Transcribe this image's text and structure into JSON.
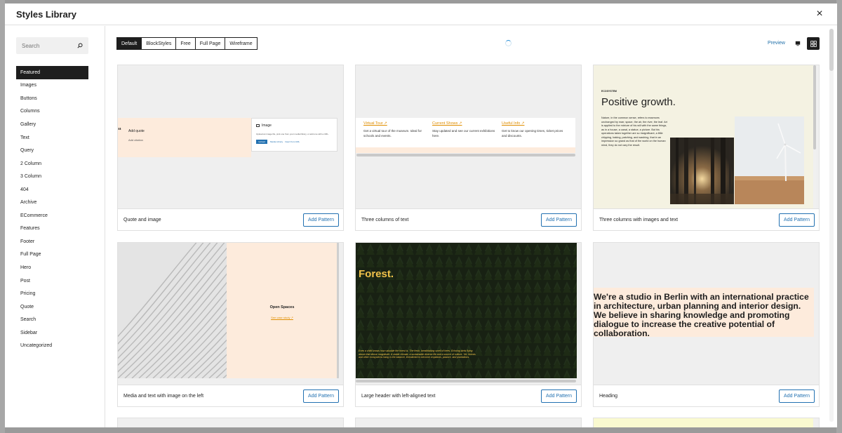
{
  "modal": {
    "title": "Styles Library",
    "close_label": "×"
  },
  "search": {
    "placeholder": "Search"
  },
  "categories": [
    "Featured",
    "Images",
    "Buttons",
    "Columns",
    "Gallery",
    "Text",
    "Query",
    "2 Column",
    "3 Column",
    "404",
    "Archive",
    "ECommerce",
    "Features",
    "Footer",
    "Full Page",
    "Hero",
    "Post",
    "Pricing",
    "Quote",
    "Search",
    "Sidebar",
    "Uncategorized"
  ],
  "active_category": "Featured",
  "tabs": [
    "Default",
    "BlockStyles",
    "Free",
    "Full Page",
    "Wireframe"
  ],
  "active_tab": "Default",
  "toolbar": {
    "preview_label": "Preview"
  },
  "add_label": "Add Pattern",
  "patterns": [
    {
      "name": "Quote and image"
    },
    {
      "name": "Three columns of text"
    },
    {
      "name": "Three columns with images and text"
    },
    {
      "name": "Media and text with image on the left"
    },
    {
      "name": "Large header with left-aligned text"
    },
    {
      "name": "Heading"
    }
  ],
  "previews": {
    "quote_image": {
      "quote": "Add quote",
      "citation": "Add citation",
      "image_title": "Image",
      "image_desc": "Upload an image file, pick one from your media library, or add one with a URL.",
      "upload": "Upload",
      "media_library": "Media Library",
      "insert_url": "Insert from URL"
    },
    "three_columns": [
      {
        "title": "Virtual Tour ↗",
        "desc": "Get a virtual tour of the museum. Ideal for schools and events."
      },
      {
        "title": "Current Shows ↗",
        "desc": "Stay updated and see our current exhibitions here."
      },
      {
        "title": "Useful Info ↗",
        "desc": "Get to know our opening times, ticket prices and discounts."
      }
    ],
    "positive_growth": {
      "kicker": "ECOSYSTEM",
      "title": "Positive growth.",
      "body": "Nature, in the common sense, refers to essences unchanged by man; space, the air, the river, the leaf. Art is applied to the mixture of his will with the same things, as in a house, a canal, a statue, a picture. But his operations taken together are so insignificant, a little chipping, baking, patching, and washing, that in an impression so grand as that of the world on the human mind, they do not vary the result."
    },
    "media_text": {
      "title": "Open Spaces",
      "link": "See case study ↗"
    },
    "forest": {
      "title": "Forest.",
      "text": "Even a child knows how valuable the forest is. The fresh, breathtaking smell of trees. Echoing birds flying above that dense magnitude. A stable climate, a sustainable diverse life and a source of culture. Yet, forests and other ecosystems hang in the balance, threatened to become croplands, pasture, and plantations."
    },
    "heading": {
      "text": "We're a studio in Berlin with an international practice in architecture, urban planning and interior design. We believe in sharing knowledge and promoting dialogue to increase the creative potential of collaboration."
    }
  },
  "colors": {
    "accent": "#2271b1",
    "dark": "#1e1e1e",
    "peach": "#fdebdc",
    "orange_link": "#e08e00",
    "forest_yellow": "#f0c24a"
  }
}
